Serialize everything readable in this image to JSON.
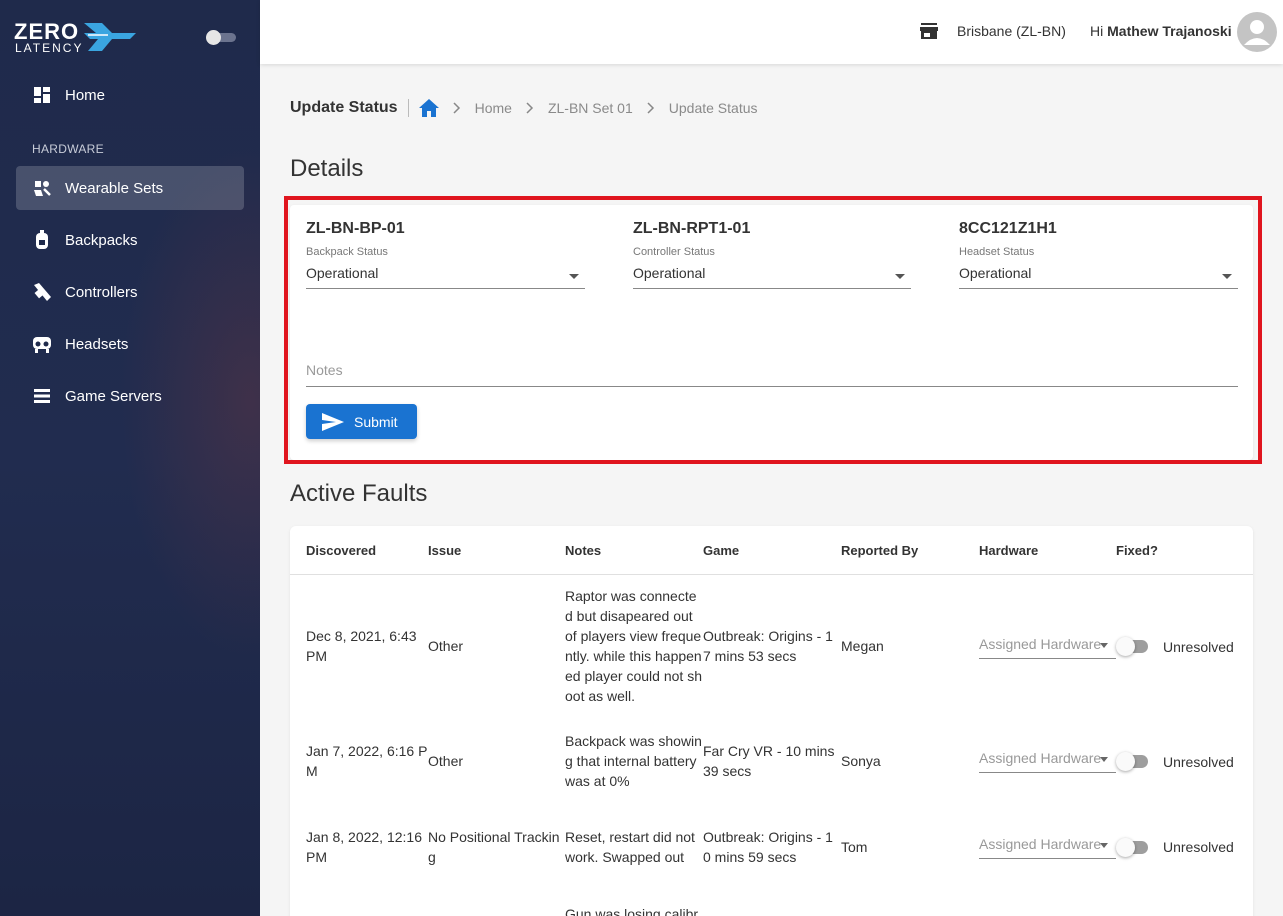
{
  "brand": {
    "line1": "ZERO",
    "line2": "LATENCY"
  },
  "sidebar": {
    "home": "Home",
    "section": "HARDWARE",
    "items": [
      {
        "label": "Wearable Sets",
        "icon": "wearable-set-icon"
      },
      {
        "label": "Backpacks",
        "icon": "backpack-icon"
      },
      {
        "label": "Controllers",
        "icon": "controller-icon"
      },
      {
        "label": "Headsets",
        "icon": "headset-icon"
      },
      {
        "label": "Game Servers",
        "icon": "server-icon"
      }
    ]
  },
  "topbar": {
    "location": "Brisbane (ZL-BN)",
    "greeting": "Hi",
    "user": "Mathew Trajanoski"
  },
  "breadcrumb": {
    "title": "Update Status",
    "items": [
      "Home",
      "ZL-BN Set 01",
      "Update Status"
    ]
  },
  "details": {
    "heading": "Details",
    "hardware": [
      {
        "name": "ZL-BN-BP-01",
        "label": "Backpack Status",
        "value": "Operational"
      },
      {
        "name": "ZL-BN-RPT1-01",
        "label": "Controller Status",
        "value": "Operational"
      },
      {
        "name": "8CC121Z1H1",
        "label": "Headset Status",
        "value": "Operational"
      }
    ],
    "notes_placeholder": "Notes",
    "submit": "Submit"
  },
  "faults": {
    "heading": "Active Faults",
    "columns": [
      "Discovered",
      "Issue",
      "Notes",
      "Game",
      "Reported By",
      "Hardware",
      "Fixed?"
    ],
    "rows": [
      {
        "discovered": "Dec 8, 2021, 6:43 PM",
        "issue": "Other",
        "notes": "Raptor was connected but disapeared out of players view frequently. while this happened player could not shoot as well.",
        "game": "Outbreak: Origins - 17 mins 53 secs",
        "reported_by": "Megan",
        "hardware": "Assigned Hardware",
        "fixed": "Unresolved"
      },
      {
        "discovered": "Jan 7, 2022, 6:16 PM",
        "issue": "Other",
        "notes": "Backpack was showing that internal battery was at 0%",
        "game": "Far Cry VR - 10 mins 39 secs",
        "reported_by": "Sonya",
        "hardware": "Assigned Hardware",
        "fixed": "Unresolved"
      },
      {
        "discovered": "Jan 8, 2022, 12:16 PM",
        "issue": "No Positional Tracking",
        "notes": "Reset, restart did not work. Swapped out",
        "game": "Outbreak: Origins - 10 mins 59 secs",
        "reported_by": "Tom",
        "hardware": "Assigned Hardware",
        "fixed": "Unresolved"
      },
      {
        "notes": "Gun was losing calibr"
      }
    ]
  },
  "colors": {
    "sidebar": "#1f2a4b",
    "primary": "#1a73d1",
    "highlight": "#e0151e"
  }
}
